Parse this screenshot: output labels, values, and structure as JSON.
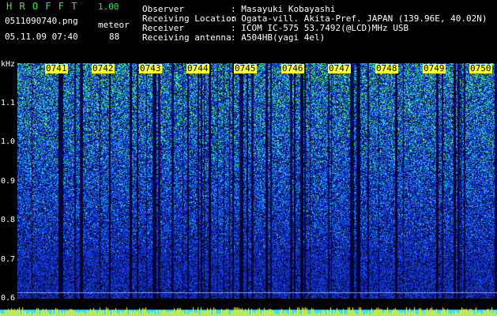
{
  "header": {
    "brand": "H R O F F T",
    "version": "1.00",
    "filename": "0511090740.png",
    "mode_label": "meteor",
    "datetime": "05.11.09 07:40",
    "count": "88",
    "info": [
      {
        "label": "Observer",
        "value": ": Masayuki Kobayashi"
      },
      {
        "label": "Receiving Location",
        "value": ": Ogata-vill. Akita-Pref. JAPAN (139.96E, 40.02N)"
      },
      {
        "label": "Receiver",
        "value": ": ICOM IC-575 53.7492(@LCD)MHz USB"
      },
      {
        "label": "Receiving antenna",
        "value": ": A504HB(yagi 4el)"
      }
    ]
  },
  "axes": {
    "y_unit": "kHz",
    "y_ticks": [
      "1.1",
      "1.0",
      "0.9",
      "0.8",
      "0.7",
      "0.6"
    ],
    "x_ticks": [
      "0741",
      "0742",
      "0743",
      "0744",
      "0745",
      "0746",
      "0747",
      "0748",
      "0749",
      "0750"
    ]
  },
  "colors": {
    "background": "#000000",
    "header_green": "#39e639",
    "tick_yellow": "#ffff33",
    "signal_blue": "#1a3cff",
    "signal_cyan": "#33e0ff",
    "signal_green": "#7fff5a"
  }
}
